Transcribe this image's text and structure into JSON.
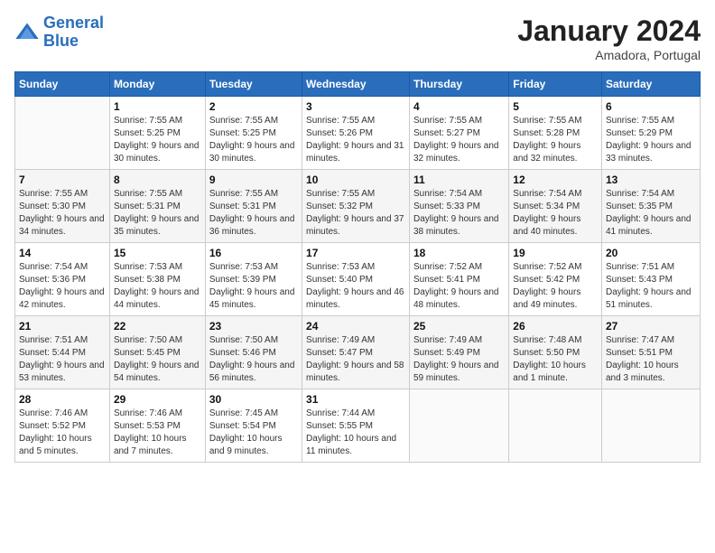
{
  "logo": {
    "line1": "General",
    "line2": "Blue"
  },
  "title": "January 2024",
  "subtitle": "Amadora, Portugal",
  "weekdays": [
    "Sunday",
    "Monday",
    "Tuesday",
    "Wednesday",
    "Thursday",
    "Friday",
    "Saturday"
  ],
  "weeks": [
    [
      {
        "day": "",
        "sunrise": "",
        "sunset": "",
        "daylight": ""
      },
      {
        "day": "1",
        "sunrise": "Sunrise: 7:55 AM",
        "sunset": "Sunset: 5:25 PM",
        "daylight": "Daylight: 9 hours and 30 minutes."
      },
      {
        "day": "2",
        "sunrise": "Sunrise: 7:55 AM",
        "sunset": "Sunset: 5:25 PM",
        "daylight": "Daylight: 9 hours and 30 minutes."
      },
      {
        "day": "3",
        "sunrise": "Sunrise: 7:55 AM",
        "sunset": "Sunset: 5:26 PM",
        "daylight": "Daylight: 9 hours and 31 minutes."
      },
      {
        "day": "4",
        "sunrise": "Sunrise: 7:55 AM",
        "sunset": "Sunset: 5:27 PM",
        "daylight": "Daylight: 9 hours and 32 minutes."
      },
      {
        "day": "5",
        "sunrise": "Sunrise: 7:55 AM",
        "sunset": "Sunset: 5:28 PM",
        "daylight": "Daylight: 9 hours and 32 minutes."
      },
      {
        "day": "6",
        "sunrise": "Sunrise: 7:55 AM",
        "sunset": "Sunset: 5:29 PM",
        "daylight": "Daylight: 9 hours and 33 minutes."
      }
    ],
    [
      {
        "day": "7",
        "sunrise": "Sunrise: 7:55 AM",
        "sunset": "Sunset: 5:30 PM",
        "daylight": "Daylight: 9 hours and 34 minutes."
      },
      {
        "day": "8",
        "sunrise": "Sunrise: 7:55 AM",
        "sunset": "Sunset: 5:31 PM",
        "daylight": "Daylight: 9 hours and 35 minutes."
      },
      {
        "day": "9",
        "sunrise": "Sunrise: 7:55 AM",
        "sunset": "Sunset: 5:31 PM",
        "daylight": "Daylight: 9 hours and 36 minutes."
      },
      {
        "day": "10",
        "sunrise": "Sunrise: 7:55 AM",
        "sunset": "Sunset: 5:32 PM",
        "daylight": "Daylight: 9 hours and 37 minutes."
      },
      {
        "day": "11",
        "sunrise": "Sunrise: 7:54 AM",
        "sunset": "Sunset: 5:33 PM",
        "daylight": "Daylight: 9 hours and 38 minutes."
      },
      {
        "day": "12",
        "sunrise": "Sunrise: 7:54 AM",
        "sunset": "Sunset: 5:34 PM",
        "daylight": "Daylight: 9 hours and 40 minutes."
      },
      {
        "day": "13",
        "sunrise": "Sunrise: 7:54 AM",
        "sunset": "Sunset: 5:35 PM",
        "daylight": "Daylight: 9 hours and 41 minutes."
      }
    ],
    [
      {
        "day": "14",
        "sunrise": "Sunrise: 7:54 AM",
        "sunset": "Sunset: 5:36 PM",
        "daylight": "Daylight: 9 hours and 42 minutes."
      },
      {
        "day": "15",
        "sunrise": "Sunrise: 7:53 AM",
        "sunset": "Sunset: 5:38 PM",
        "daylight": "Daylight: 9 hours and 44 minutes."
      },
      {
        "day": "16",
        "sunrise": "Sunrise: 7:53 AM",
        "sunset": "Sunset: 5:39 PM",
        "daylight": "Daylight: 9 hours and 45 minutes."
      },
      {
        "day": "17",
        "sunrise": "Sunrise: 7:53 AM",
        "sunset": "Sunset: 5:40 PM",
        "daylight": "Daylight: 9 hours and 46 minutes."
      },
      {
        "day": "18",
        "sunrise": "Sunrise: 7:52 AM",
        "sunset": "Sunset: 5:41 PM",
        "daylight": "Daylight: 9 hours and 48 minutes."
      },
      {
        "day": "19",
        "sunrise": "Sunrise: 7:52 AM",
        "sunset": "Sunset: 5:42 PM",
        "daylight": "Daylight: 9 hours and 49 minutes."
      },
      {
        "day": "20",
        "sunrise": "Sunrise: 7:51 AM",
        "sunset": "Sunset: 5:43 PM",
        "daylight": "Daylight: 9 hours and 51 minutes."
      }
    ],
    [
      {
        "day": "21",
        "sunrise": "Sunrise: 7:51 AM",
        "sunset": "Sunset: 5:44 PM",
        "daylight": "Daylight: 9 hours and 53 minutes."
      },
      {
        "day": "22",
        "sunrise": "Sunrise: 7:50 AM",
        "sunset": "Sunset: 5:45 PM",
        "daylight": "Daylight: 9 hours and 54 minutes."
      },
      {
        "day": "23",
        "sunrise": "Sunrise: 7:50 AM",
        "sunset": "Sunset: 5:46 PM",
        "daylight": "Daylight: 9 hours and 56 minutes."
      },
      {
        "day": "24",
        "sunrise": "Sunrise: 7:49 AM",
        "sunset": "Sunset: 5:47 PM",
        "daylight": "Daylight: 9 hours and 58 minutes."
      },
      {
        "day": "25",
        "sunrise": "Sunrise: 7:49 AM",
        "sunset": "Sunset: 5:49 PM",
        "daylight": "Daylight: 9 hours and 59 minutes."
      },
      {
        "day": "26",
        "sunrise": "Sunrise: 7:48 AM",
        "sunset": "Sunset: 5:50 PM",
        "daylight": "Daylight: 10 hours and 1 minute."
      },
      {
        "day": "27",
        "sunrise": "Sunrise: 7:47 AM",
        "sunset": "Sunset: 5:51 PM",
        "daylight": "Daylight: 10 hours and 3 minutes."
      }
    ],
    [
      {
        "day": "28",
        "sunrise": "Sunrise: 7:46 AM",
        "sunset": "Sunset: 5:52 PM",
        "daylight": "Daylight: 10 hours and 5 minutes."
      },
      {
        "day": "29",
        "sunrise": "Sunrise: 7:46 AM",
        "sunset": "Sunset: 5:53 PM",
        "daylight": "Daylight: 10 hours and 7 minutes."
      },
      {
        "day": "30",
        "sunrise": "Sunrise: 7:45 AM",
        "sunset": "Sunset: 5:54 PM",
        "daylight": "Daylight: 10 hours and 9 minutes."
      },
      {
        "day": "31",
        "sunrise": "Sunrise: 7:44 AM",
        "sunset": "Sunset: 5:55 PM",
        "daylight": "Daylight: 10 hours and 11 minutes."
      },
      {
        "day": "",
        "sunrise": "",
        "sunset": "",
        "daylight": ""
      },
      {
        "day": "",
        "sunrise": "",
        "sunset": "",
        "daylight": ""
      },
      {
        "day": "",
        "sunrise": "",
        "sunset": "",
        "daylight": ""
      }
    ]
  ]
}
